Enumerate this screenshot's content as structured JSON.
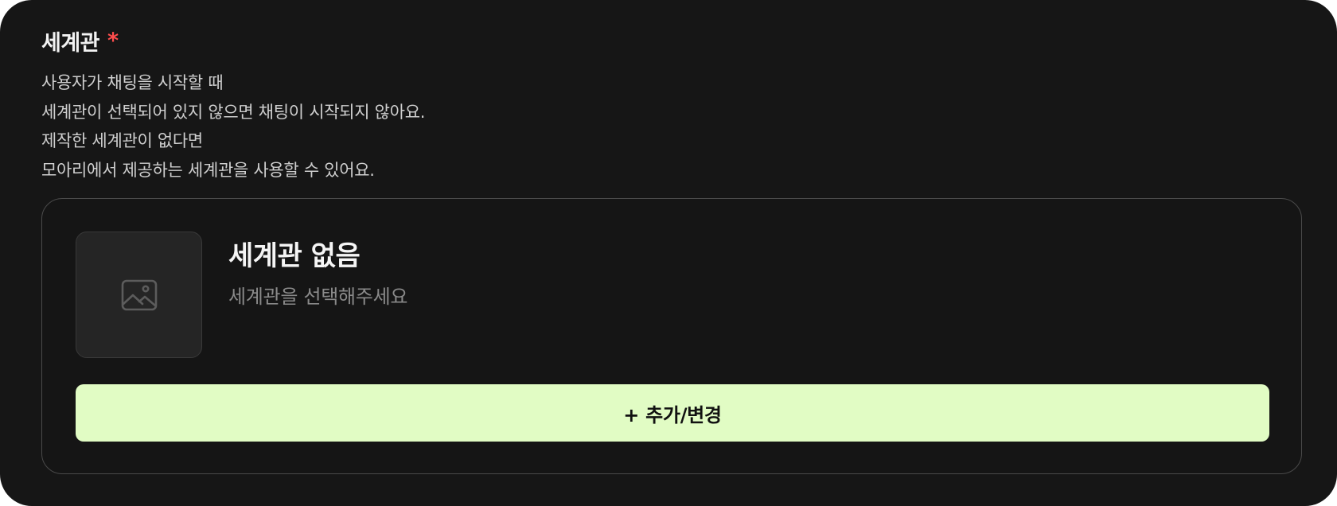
{
  "section": {
    "title": "세계관",
    "required_mark": "*",
    "description_lines": [
      "사용자가 채팅을 시작할 때",
      "세계관이 선택되어 있지 않으면 채팅이 시작되지 않아요.",
      "제작한 세계관이 없다면",
      "모아리에서 제공하는 세계관을 사용할 수 있어요."
    ]
  },
  "card": {
    "thumbnail_icon": "image-placeholder-icon",
    "title": "세계관 없음",
    "subtitle": "세계관을 선택해주세요"
  },
  "actions": {
    "add_change_label": "+ 추가/변경"
  },
  "colors": {
    "background": "#161616",
    "required": "#ff4d4d",
    "button_bg": "#e1fcc4",
    "muted_text": "#8a8a8a"
  }
}
